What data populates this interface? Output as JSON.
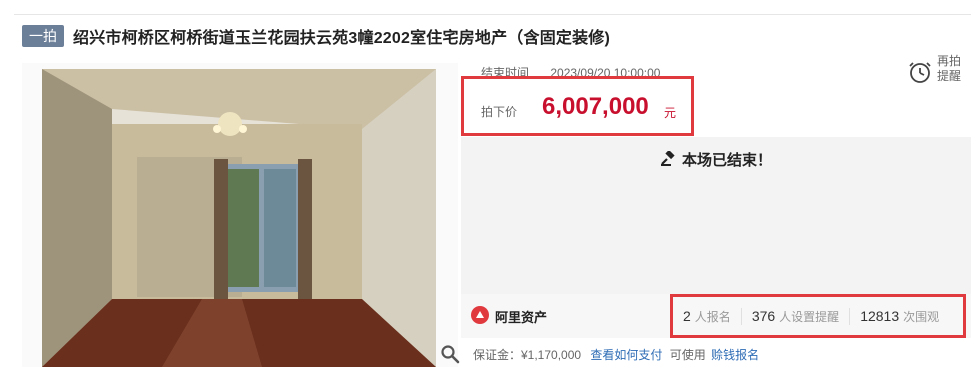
{
  "header": {
    "badge": "一拍",
    "title": "绍兴市柯桥区柯桥街道玉兰花园扶云苑3幢2202室住宅房地产（含固定装修)"
  },
  "auction": {
    "end_time_label": "结束时间",
    "end_time_value": "2023/09/20 10:00:00",
    "price_label": "拍下价",
    "price_value": "6,007,000",
    "price_unit": "元",
    "remind_label_1": "再拍",
    "remind_label_2": "提醒",
    "ended_text": "本场已结束！"
  },
  "brand": {
    "name": "阿里资产"
  },
  "stats": [
    {
      "num": "2",
      "label": "人报名"
    },
    {
      "num": "376",
      "label": "人设置提醒"
    },
    {
      "num": "12813",
      "label": "次围观"
    }
  ],
  "deposit": {
    "label": "保证金：¥1,170,000",
    "link_pay": "查看如何支付",
    "usable": "可使用",
    "link_signup": "赊钱报名"
  },
  "colors": {
    "accent": "#c8102e",
    "highlight_border": "#e0393e",
    "badge": "#6b7f99"
  }
}
